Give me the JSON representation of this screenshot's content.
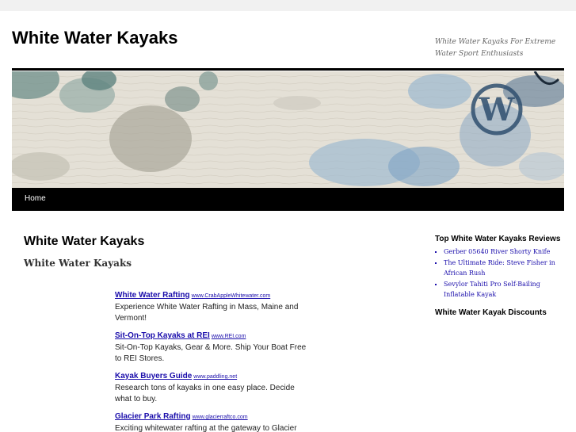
{
  "site": {
    "title": "White Water Kayaks",
    "description": "White Water Kayaks For Extreme Water Sport Enthusiasts"
  },
  "nav": {
    "items": [
      {
        "label": "Home"
      }
    ]
  },
  "entry": {
    "title": "White Water Kayaks",
    "subtitle": "White Water Kayaks"
  },
  "ads": [
    {
      "title": "White Water Rafting",
      "url": "www.CrabAppleWhitewater.com",
      "description": "Experience White Water Rafting in Mass, Maine and Vermont!"
    },
    {
      "title": "Sit-On-Top Kayaks at REI",
      "url": "www.REI.com",
      "description": "Sit-On-Top Kayaks, Gear & More. Ship Your Boat Free to REI Stores."
    },
    {
      "title": "Kayak Buyers Guide",
      "url": "www.paddling.net",
      "description": "Research tons of kayaks in one easy place. Decide what to buy."
    },
    {
      "title": "Glacier Park Rafting",
      "url": "www.glacierraftco.com",
      "description": "Exciting whitewater rafting at the gateway to Glacier National Park!"
    }
  ],
  "sidebar": {
    "widget1_title": "Top White Water Kayaks Reviews",
    "widget1_items": [
      {
        "label": "Gerber 05640 River Shorty Knife"
      },
      {
        "label": "The Ultimate Ride: Steve Fisher in African Rush"
      },
      {
        "label": "Sevylor Tahiti Pro Self-Bailing Inflatable Kayak"
      }
    ],
    "widget2_title": "White Water Kayak Discounts"
  },
  "colors": {
    "link": "#1a0dab",
    "nav_background": "#000000",
    "page_background": "#f1f1f1"
  },
  "icons": {
    "header_logo": "wordpress-logo-icon"
  }
}
